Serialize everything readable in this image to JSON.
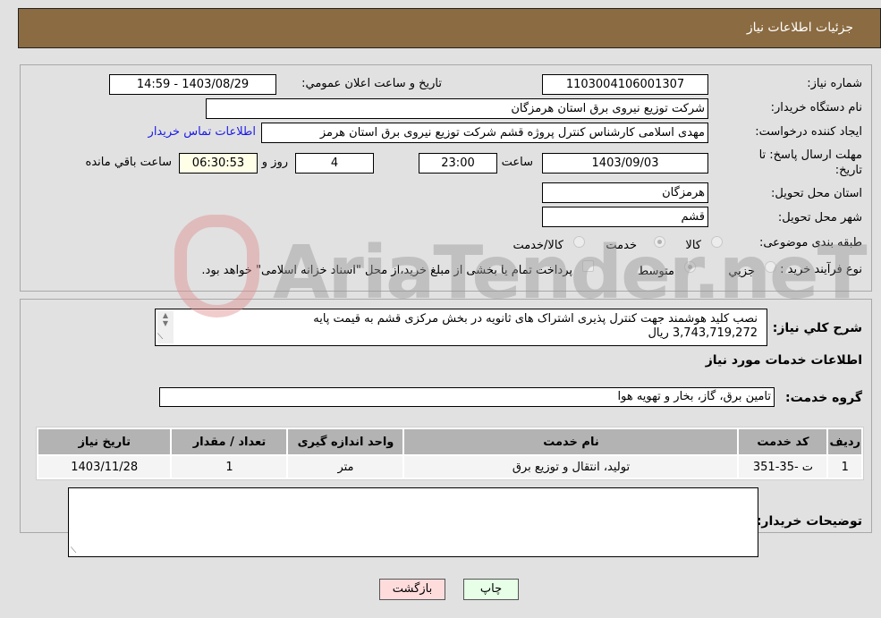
{
  "header": {
    "title": "جزئیات اطلاعات نیاز"
  },
  "watermark": {
    "text": "AriaTender.neT"
  },
  "details": {
    "need_number_label": "شماره نیاز:",
    "need_number": "1103004106001307",
    "announce_label": "تاريخ و ساعت اعلان عمومي:",
    "announce_value": "1403/08/29 - 14:59",
    "buyer_org_label": "نام دستگاه خریدار:",
    "buyer_org": "شرکت توزیع نیروی برق استان هرمزگان",
    "creator_label": "ایجاد کننده درخواست:",
    "creator": "مهدی اسلامی کارشناس کنترل پروژه قشم شرکت توزیع نیروی برق استان هرمز",
    "contact_link": "اطلاعات تماس خریدار",
    "deadline_label": "مهلت ارسال پاسخ: تا تاریخ:",
    "deadline_date": "1403/09/03",
    "time_label": "ساعت",
    "deadline_time": "23:00",
    "days_value": "4",
    "days_label": "روز و",
    "remaining_time": "06:30:53",
    "remaining_label": "ساعت باقي مانده",
    "province_label": "استان محل تحویل:",
    "province": "هرمزگان",
    "city_label": "شهر محل تحویل:",
    "city": "قشم",
    "category_label": "طبقه بندی موضوعی:",
    "category_options": [
      {
        "label": "کالا",
        "selected": false
      },
      {
        "label": "خدمت",
        "selected": true
      },
      {
        "label": "کالا/خدمت",
        "selected": false
      }
    ],
    "process_label": "نوع فرآیند خرید :",
    "process_options": [
      {
        "label": "جزيي",
        "selected": false
      },
      {
        "label": "متوسط",
        "selected": true
      }
    ],
    "payment_note": "پرداخت تمام یا بخشی از مبلغ خرید،از محل \"اسناد خزانه اسلامی\" خواهد بود.",
    "payment_checked": false
  },
  "services": {
    "desc_label": "شرح کلي نياز:",
    "desc_line1": "نصب کلید هوشمند جهت کنترل پذیری اشتراک های ثانویه در بخش مرکزی قشم به قیمت پایه",
    "desc_line2": "3,743,719,272 ریال",
    "section_title": "اطلاعات خدمات مورد نياز",
    "group_label": "گروه خدمت:",
    "group_value": "تامین برق، گاز، بخار و تهویه هوا",
    "table": {
      "headers": [
        "رديف",
        "کد خدمت",
        "نام خدمت",
        "واحد اندازه گيری",
        "تعداد / مقدار",
        "تاريخ نياز"
      ],
      "rows": [
        [
          "1",
          "ت -35-351",
          "تولید، انتقال و توزیع برق",
          "متر",
          "1",
          "1403/11/28"
        ]
      ]
    },
    "notes_label": "توضیحات خريدار:",
    "notes_value": ""
  },
  "buttons": {
    "print": "چاپ",
    "back": "بازگشت"
  }
}
